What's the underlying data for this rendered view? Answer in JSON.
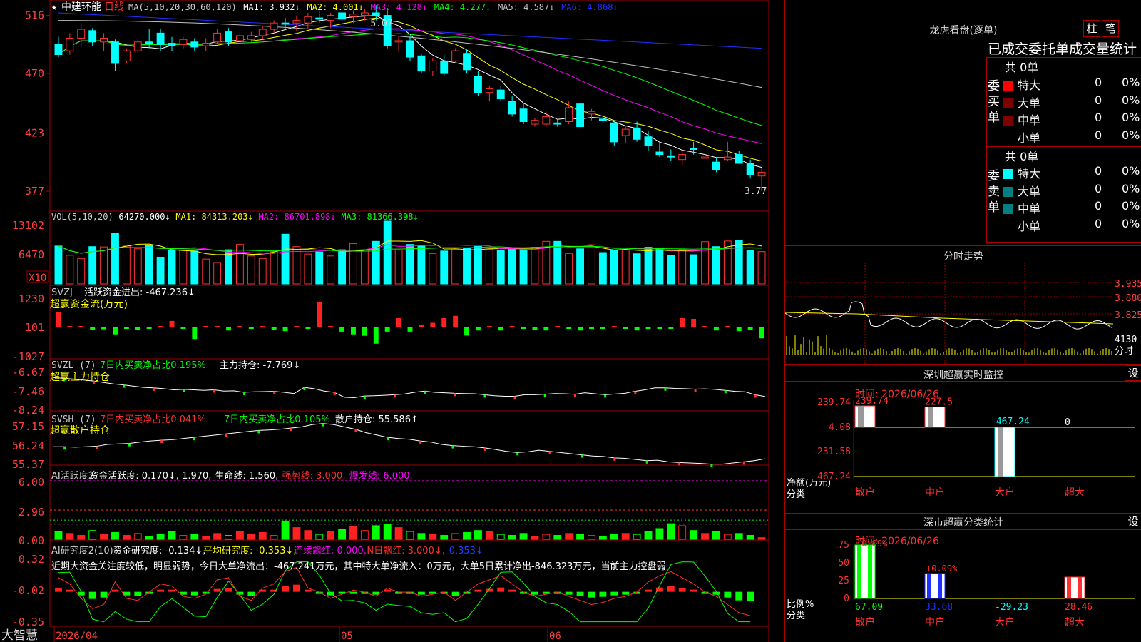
{
  "chart_data": {
    "type": "candlestick",
    "stock": "中建环能",
    "period": "日线",
    "brand": "大智慧",
    "ma_legend": [
      "MA(5,10,20,30,60,120)",
      "MA1: 3.932↓",
      "MA2: 4.001↓",
      "MA3: 4.128↓",
      "MA4: 4.277↓",
      "MA5: 4.587↓",
      "MA6: 4.868↓"
    ],
    "price_ticks": [
      "516",
      "470",
      "423",
      "377"
    ],
    "high_label": "5.07",
    "low_label": "3.77",
    "date_labels": [
      "2026/04",
      "05",
      "06"
    ],
    "ohlc": [
      [
        4.93,
        4.99,
        4.83,
        4.85
      ],
      [
        4.88,
        5.02,
        4.85,
        4.98
      ],
      [
        4.98,
        5.1,
        4.92,
        5.05
      ],
      [
        5.04,
        5.06,
        4.92,
        4.95
      ],
      [
        4.95,
        5.02,
        4.88,
        4.98
      ],
      [
        4.95,
        4.97,
        4.72,
        4.78
      ],
      [
        4.8,
        4.9,
        4.78,
        4.88
      ],
      [
        4.88,
        4.98,
        4.87,
        4.95
      ],
      [
        4.95,
        5.05,
        4.9,
        4.94
      ],
      [
        5.02,
        5.05,
        4.88,
        4.93
      ],
      [
        4.94,
        4.99,
        4.88,
        4.92
      ],
      [
        4.93,
        4.99,
        4.9,
        4.97
      ],
      [
        4.95,
        4.98,
        4.88,
        4.91
      ],
      [
        4.92,
        4.98,
        4.88,
        4.94
      ],
      [
        4.95,
        5.05,
        4.93,
        5.02
      ],
      [
        5.03,
        5.06,
        4.92,
        4.95
      ],
      [
        4.96,
        5.03,
        4.94,
        5.0
      ],
      [
        4.97,
        5.03,
        4.95,
        5.0
      ],
      [
        5.0,
        5.08,
        4.97,
        5.05
      ],
      [
        5.05,
        5.12,
        5.02,
        5.1
      ],
      [
        5.1,
        5.14,
        5.05,
        5.09
      ],
      [
        5.1,
        5.16,
        5.04,
        5.12
      ],
      [
        5.1,
        5.18,
        5.05,
        5.15
      ],
      [
        5.14,
        5.2,
        5.1,
        5.13
      ],
      [
        5.12,
        5.18,
        5.06,
        5.16
      ],
      [
        5.18,
        5.22,
        5.11,
        5.13
      ],
      [
        5.15,
        5.2,
        5.1,
        5.17
      ],
      [
        5.16,
        5.21,
        5.12,
        5.18
      ],
      [
        5.18,
        5.24,
        5.12,
        5.16
      ],
      [
        5.16,
        5.22,
        4.9,
        4.92
      ],
      [
        4.95,
        5.0,
        4.88,
        4.96
      ],
      [
        4.96,
        5.0,
        4.8,
        4.83
      ],
      [
        4.84,
        4.86,
        4.7,
        4.72
      ],
      [
        4.72,
        4.82,
        4.68,
        4.8
      ],
      [
        4.8,
        4.85,
        4.68,
        4.7
      ],
      [
        4.8,
        4.9,
        4.78,
        4.88
      ],
      [
        4.86,
        4.89,
        4.7,
        4.73
      ],
      [
        4.68,
        4.72,
        4.52,
        4.55
      ],
      [
        4.55,
        4.6,
        4.48,
        4.58
      ],
      [
        4.57,
        4.6,
        4.48,
        4.5
      ],
      [
        4.48,
        4.52,
        4.36,
        4.38
      ],
      [
        4.42,
        4.46,
        4.3,
        4.32
      ],
      [
        4.3,
        4.35,
        4.28,
        4.33
      ],
      [
        4.3,
        4.4,
        4.28,
        4.36
      ],
      [
        4.31,
        4.34,
        4.28,
        4.3
      ],
      [
        4.32,
        4.48,
        4.3,
        4.43
      ],
      [
        4.46,
        4.48,
        4.26,
        4.28
      ],
      [
        4.38,
        4.42,
        4.33,
        4.4
      ],
      [
        4.34,
        4.37,
        4.3,
        4.33
      ],
      [
        4.31,
        4.33,
        4.13,
        4.16
      ],
      [
        4.21,
        4.28,
        4.15,
        4.26
      ],
      [
        4.27,
        4.32,
        4.16,
        4.18
      ],
      [
        4.2,
        4.25,
        4.09,
        4.13
      ],
      [
        4.08,
        4.15,
        4.04,
        4.06
      ],
      [
        4.05,
        4.1,
        4.01,
        4.04
      ],
      [
        4.02,
        4.1,
        3.97,
        4.06
      ],
      [
        4.11,
        4.16,
        4.06,
        4.1
      ],
      [
        4.03,
        4.06,
        3.99,
        4.04
      ],
      [
        4.0,
        4.04,
        3.92,
        3.94
      ],
      [
        4.02,
        4.16,
        4.01,
        4.04
      ],
      [
        4.06,
        4.09,
        3.99,
        3.99
      ],
      [
        3.99,
        4.02,
        3.87,
        3.9
      ],
      [
        3.89,
        3.95,
        3.77,
        3.92
      ]
    ],
    "vol_legend": [
      "VOL(5,10,20)",
      "64270.000↓",
      "MA1: 84313.203↓",
      "MA2: 86701.898↓",
      "MA3: 81366.398↓"
    ],
    "vol_ticks": [
      "13102",
      "6470",
      "X10"
    ],
    "volume": [
      12200,
      9200,
      8200,
      12000,
      11900,
      16400,
      12200,
      11300,
      12300,
      8600,
      10700,
      10800,
      10600,
      8000,
      6900,
      11000,
      12700,
      9000,
      8200,
      10400,
      16000,
      12000,
      9600,
      10300,
      9000,
      11000,
      13000,
      11000,
      13700,
      20200,
      10900,
      12700,
      12200,
      9800,
      10600,
      11200,
      11400,
      12100,
      11200,
      10800,
      11400,
      11000,
      11800,
      13700,
      13700,
      9800,
      11300,
      12600,
      10100,
      10700,
      11000,
      9700,
      11800,
      11600,
      9100,
      11000,
      9400,
      13600,
      12000,
      13800,
      14000,
      10800,
      10400
    ],
    "svzj_legend": [
      "SVZJ",
      "活跃资金进出: -467.236↓",
      "超赢资金流(万元)"
    ],
    "svzj_ticks": [
      "1230",
      "101",
      "-1027"
    ],
    "svzj": [
      650,
      0,
      0,
      -100,
      -80,
      -300,
      -60,
      -120,
      -60,
      50,
      280,
      -60,
      -500,
      0,
      0,
      -130,
      0,
      -60,
      0,
      -120,
      -160,
      0,
      -50,
      1080,
      0,
      -180,
      -300,
      -360,
      -700,
      -180,
      400,
      -180,
      100,
      200,
      400,
      500,
      -350,
      -130,
      0,
      -130,
      0,
      -60,
      -120,
      -130,
      0,
      -50,
      -130,
      -60,
      -60,
      0,
      -60,
      -130,
      -60,
      -60,
      -60,
      400,
      370,
      0,
      -130,
      0,
      -160,
      -100,
      -467
    ],
    "svzl_legend": [
      "SVZL (7)",
      "7日内买卖净占比0.195%",
      "主力持仓: -7.769↓",
      "超赢主力持仓"
    ],
    "svzl_ticks": [
      "-6.67",
      "-7.46",
      "-8.24"
    ],
    "svzl": [
      -7.0,
      -7.03,
      -7.06,
      -7.1,
      -7.14,
      -7.2,
      -7.26,
      -7.3,
      -7.35,
      -7.4,
      -7.42,
      -7.45,
      -7.5,
      -7.48,
      -7.5,
      -7.52,
      -7.5,
      -7.55,
      -7.54,
      -7.6,
      -7.58,
      -7.57,
      -7.56,
      -7.6,
      -7.65,
      -7.4,
      -7.45,
      -7.55,
      -7.6,
      -7.8,
      -7.82,
      -7.75,
      -7.74,
      -7.72,
      -7.7,
      -7.67,
      -7.6,
      -7.55,
      -7.6,
      -7.62,
      -7.64,
      -7.65,
      -7.66,
      -7.7,
      -7.74,
      -7.76,
      -7.76,
      -7.7,
      -7.7,
      -7.68,
      -7.65,
      -7.66,
      -7.68,
      -7.62,
      -7.66,
      -7.7,
      -7.67,
      -7.64,
      -7.56,
      -7.5,
      -7.42,
      -7.42,
      -7.44,
      -7.45,
      -7.47,
      -7.46,
      -7.48,
      -7.52,
      -7.56,
      -7.58,
      -7.7,
      -7.77
    ],
    "svsh_legend": [
      "SVSH (7)",
      "7日内买卖净占比0.041%",
      "7日内买卖净占比0.105%",
      "散户持仓: 55.586↑",
      "超赢散户持仓"
    ],
    "svsh_ticks": [
      "57.15",
      "56.24",
      "55.37"
    ],
    "svsh": [
      56.1,
      56.1,
      56.08,
      56.1,
      56.12,
      56.2,
      56.22,
      56.24,
      56.3,
      56.35,
      56.38,
      56.4,
      56.45,
      56.5,
      56.55,
      56.6,
      56.65,
      56.7,
      56.75,
      56.8,
      56.82,
      56.85,
      56.9,
      56.95,
      57.05,
      57.1,
      57.05,
      56.95,
      56.85,
      56.7,
      56.6,
      56.5,
      56.45,
      56.42,
      56.35,
      56.3,
      56.2,
      56.15,
      56.12,
      56.1,
      56.05,
      55.98,
      55.9,
      55.85,
      55.88,
      55.95,
      55.9,
      55.85,
      55.8,
      55.75,
      55.7,
      55.68,
      55.62,
      55.6,
      55.55,
      55.5,
      55.52,
      55.45,
      55.42,
      55.4,
      55.38,
      55.35,
      55.35,
      55.4,
      55.45,
      55.5,
      55.58
    ],
    "ai1_legend": [
      "AI活跃度2",
      "资金活跃度: 0.170↓, 1.970,",
      "生命线: 1.560,",
      "强势线: 3.000,",
      "爆发线: 6.000,"
    ],
    "ai1_ticks": [
      "6.00",
      "2.96",
      "0.00"
    ],
    "ai1": [
      0.8,
      0.6,
      0.4,
      0.9,
      0.5,
      0.7,
      0.4,
      0.6,
      0.3,
      0.5,
      0.8,
      0.4,
      0.5,
      0.3,
      0.6,
      0.4,
      0.8,
      0.5,
      0.7,
      0.4,
      1.8,
      1.2,
      0.9,
      0.5,
      0.8,
      1.0,
      1.3,
      0.9,
      1.4,
      1.5,
      1.2,
      0.8,
      0.6,
      0.5,
      0.4,
      0.6,
      0.7,
      0.9,
      0.8,
      0.5,
      0.4,
      0.6,
      0.3,
      0.5,
      0.4,
      0.6,
      0.5,
      0.4,
      0.3,
      0.5,
      0.6,
      0.5,
      0.8,
      1.1,
      1.6,
      1.4,
      0.9,
      0.6,
      0.8,
      0.5,
      0.6,
      0.4,
      0.17
    ],
    "ai2_legend": [
      "AI研究度2(10)",
      "资金研究度: -0.134↓,",
      "平均研究度: -0.353↓,",
      "连续飘红: 0.000,",
      "N日飘红: 3.000↓,",
      "-0.353↓"
    ],
    "ai2_comment": "近期大资金关注度较低，明显弱势，今日大单净流出：-467.241万元，其中特大单净流入：0万元，大单5日累计净出-846.323万元，当前主力控盘弱",
    "ai2_ticks": [
      "0.32",
      "-0.02",
      "-0.35"
    ],
    "ai2": [
      0.05,
      0.02,
      -0.05,
      -0.1,
      -0.08,
      0.03,
      -0.05,
      -0.06,
      -0.02,
      0.02,
      0.01,
      -0.04,
      -0.05,
      -0.03,
      0.04,
      0.05,
      -0.04,
      -0.06,
      0.0,
      0.02,
      0.08,
      0.1,
      0.0,
      -0.02,
      -0.05,
      -0.03,
      -0.01,
      -0.02,
      -0.04,
      0.0,
      -0.02,
      -0.02,
      -0.04,
      -0.03,
      -0.02,
      -0.06,
      -0.02,
      0.02,
      0.04,
      0.06,
      0.02,
      -0.02,
      -0.04,
      -0.03,
      -0.02,
      -0.04,
      -0.06,
      -0.08,
      -0.07,
      -0.05,
      -0.04,
      -0.02,
      0.03,
      0.06,
      0.08,
      0.05,
      0.02,
      -0.02,
      -0.04,
      -0.08,
      -0.12,
      -0.134
    ]
  },
  "right_panel": {
    "lhb": {
      "title": "龙虎看盘(逐单)",
      "btn_zhu": "柱",
      "btn_bi": "笔",
      "subtitle": "已成交委托单成交量统计",
      "buy_label": "委买单",
      "sell_label": "委卖单",
      "buy_total": "共 0单",
      "sell_total": "共 0单",
      "buy_rows": [
        {
          "name": "特大",
          "count": "0",
          "pct": "0%",
          "color": "#ff0000"
        },
        {
          "name": "大单",
          "count": "0",
          "pct": "0%",
          "color": "#800000"
        },
        {
          "name": "中单",
          "count": "0",
          "pct": "0%",
          "color": "#800000"
        },
        {
          "name": "小单",
          "count": "0",
          "pct": "0%",
          "color": "#000000"
        }
      ],
      "sell_rows": [
        {
          "name": "特大",
          "count": "0",
          "pct": "0%",
          "color": "#00ffff"
        },
        {
          "name": "大单",
          "count": "0",
          "pct": "0%",
          "color": "#008080"
        },
        {
          "name": "中单",
          "count": "0",
          "pct": "0%",
          "color": "#008080"
        },
        {
          "name": "小单",
          "count": "0",
          "pct": "0%",
          "color": "#000000"
        }
      ]
    },
    "intraday": {
      "title": "分时走势",
      "price_ticks": [
        "3.935",
        "3.880",
        "3.825"
      ],
      "vol_tick": "4130",
      "label": "分时"
    },
    "monitor": {
      "title": "深圳超赢实时监控",
      "set_btn": "设",
      "time": "时间: 2026/06/26",
      "ticks": [
        "239.74",
        "4.08",
        "-231.58",
        "-467.24"
      ],
      "bar_labels": [
        "239.74",
        "227.5",
        "-467.24",
        "0"
      ],
      "values": [
        239.74,
        227.5,
        -467.24,
        0
      ],
      "ylabel": "净额(万元)",
      "xlabel": "分类",
      "categories": [
        "散户",
        "中户",
        "大户",
        "超大"
      ]
    },
    "classify": {
      "title": "深市超赢分类统计",
      "set_btn": "设",
      "time": "时间: 2026/06/26",
      "ticks": [
        "75",
        "50",
        "25",
        "0"
      ],
      "bar_labels": [
        "+0.09%",
        "+0.09%"
      ],
      "heights": [
        75,
        35,
        0,
        30
      ],
      "values": [
        "67.09",
        "33.68",
        "-29.23",
        "28.46"
      ],
      "ylabel": "比例%",
      "xlabel": "分类",
      "categories": [
        "散户",
        "中户",
        "大户",
        "超大"
      ]
    }
  },
  "colors": {
    "up": "#ff3333",
    "down": "#00ffff",
    "grid": "#a00000",
    "ma1": "#ffffff",
    "ma2": "#ffff00",
    "ma3": "#ff00ff",
    "ma4": "#00ff00",
    "ma5": "#c0c0c0",
    "ma6": "#2030ff"
  }
}
